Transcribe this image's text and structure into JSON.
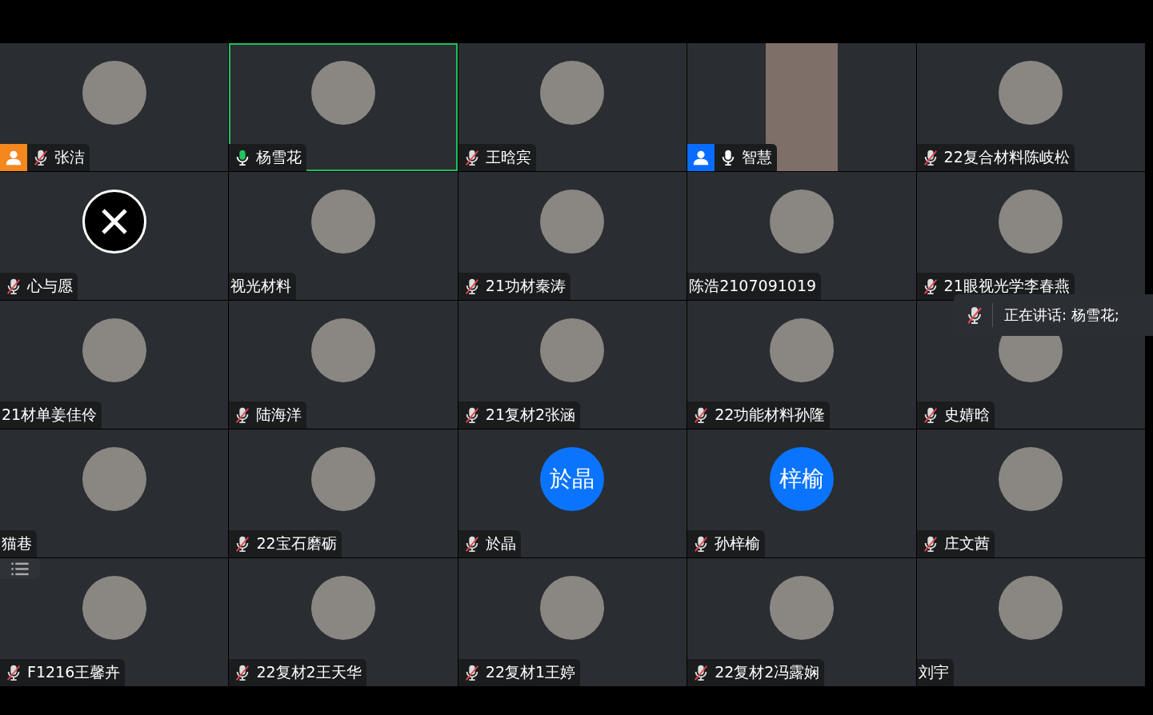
{
  "tiles": [
    {
      "name": "张洁",
      "mic": {
        "kind": "muted"
      },
      "selected": false,
      "badge": {
        "color": "#f5871f"
      },
      "avatar": {
        "kind": "photo"
      }
    },
    {
      "name": "杨雪花",
      "mic": {
        "kind": "speaking"
      },
      "selected": true,
      "avatar": {
        "kind": "photo"
      }
    },
    {
      "name": "王晗宾",
      "mic": {
        "kind": "muted"
      },
      "selected": false,
      "avatar": {
        "kind": "photo"
      }
    },
    {
      "name": "智慧",
      "mic": {
        "kind": "on"
      },
      "selected": false,
      "badge": {
        "color": "#0a6cff"
      },
      "avatar": {
        "kind": "video"
      }
    },
    {
      "name": "22复合材料陈岐松",
      "mic": {
        "kind": "muted"
      },
      "selected": false,
      "avatar": {
        "kind": "photo"
      }
    },
    {
      "name": "心与愿",
      "mic": {
        "kind": "muted"
      },
      "selected": false,
      "avatar": {
        "kind": "closed"
      }
    },
    {
      "name": "视光材料",
      "selected": false,
      "avatar": {
        "kind": "photo"
      }
    },
    {
      "name": "21功材秦涛",
      "mic": {
        "kind": "muted"
      },
      "selected": false,
      "avatar": {
        "kind": "photo"
      }
    },
    {
      "name": "陈浩2107091019",
      "selected": false,
      "avatar": {
        "kind": "photo"
      }
    },
    {
      "name": "21眼视光学李春燕",
      "mic": {
        "kind": "muted"
      },
      "selected": false,
      "avatar": {
        "kind": "photo"
      }
    },
    {
      "name": "21材单姜佳伶",
      "selected": false,
      "avatar": {
        "kind": "photo"
      }
    },
    {
      "name": "陆海洋",
      "mic": {
        "kind": "muted"
      },
      "selected": false,
      "avatar": {
        "kind": "photo"
      }
    },
    {
      "name": "21复材2张涵",
      "mic": {
        "kind": "muted"
      },
      "selected": false,
      "avatar": {
        "kind": "photo"
      }
    },
    {
      "name": "22功能材料孙隆",
      "mic": {
        "kind": "muted"
      },
      "selected": false,
      "avatar": {
        "kind": "photo"
      }
    },
    {
      "name": "史婧晗",
      "mic": {
        "kind": "muted"
      },
      "selected": false,
      "avatar": {
        "kind": "photo"
      }
    },
    {
      "name": "猫巷",
      "selected": false,
      "avatar": {
        "kind": "photo"
      }
    },
    {
      "name": "22宝石磨砺",
      "mic": {
        "kind": "muted"
      },
      "selected": false,
      "avatar": {
        "kind": "photo"
      }
    },
    {
      "name": "於晶",
      "mic": {
        "kind": "muted"
      },
      "selected": false,
      "avatar": {
        "kind": "initials",
        "text": "於晶"
      }
    },
    {
      "name": "孙梓榆",
      "mic": {
        "kind": "muted"
      },
      "selected": false,
      "avatar": {
        "kind": "initials",
        "text": "梓榆"
      }
    },
    {
      "name": "庄文茜",
      "mic": {
        "kind": "muted"
      },
      "selected": false,
      "avatar": {
        "kind": "photo"
      }
    },
    {
      "name": "F1216王馨卉",
      "mic": {
        "kind": "muted"
      },
      "selected": false,
      "avatar": {
        "kind": "photo"
      }
    },
    {
      "name": "22复材2王天华",
      "mic": {
        "kind": "muted"
      },
      "selected": false,
      "avatar": {
        "kind": "photo"
      }
    },
    {
      "name": "22复材1王婷",
      "mic": {
        "kind": "muted"
      },
      "selected": false,
      "avatar": {
        "kind": "photo"
      }
    },
    {
      "name": "22复材2冯露娴",
      "mic": {
        "kind": "muted"
      },
      "selected": false,
      "avatar": {
        "kind": "photo"
      }
    },
    {
      "name": "刘宇",
      "selected": false,
      "avatar": {
        "kind": "photo"
      }
    }
  ],
  "speaking_toast": {
    "text": "正在讲话: 杨雪花;",
    "mic": {
      "kind": "muted"
    }
  }
}
